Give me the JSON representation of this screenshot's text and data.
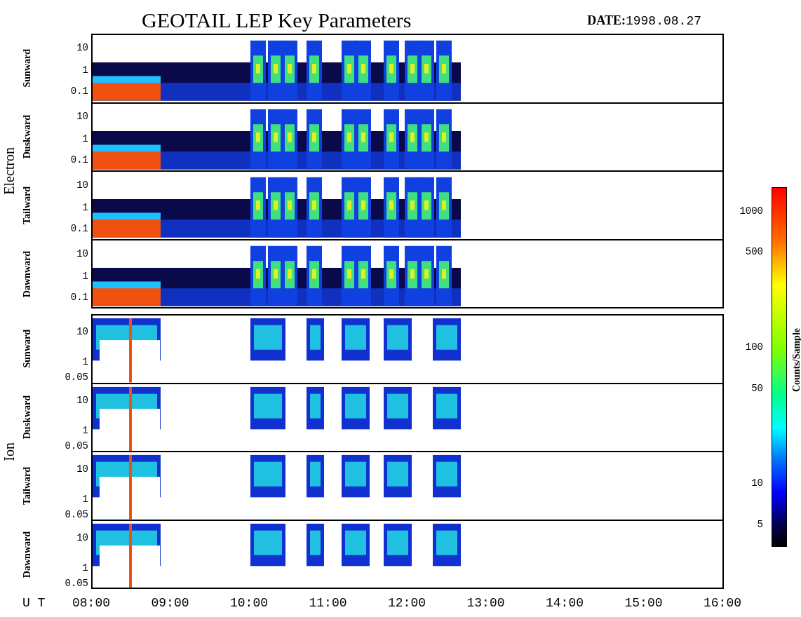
{
  "title": "GEOTAIL LEP Key Parameters",
  "date": {
    "label": "DATE:",
    "value": "1998.08.27"
  },
  "groups": [
    {
      "label": "Electron",
      "kind": "electron",
      "panels": [
        {
          "label": "Sunward",
          "ticks": [
            "10",
            "1",
            "0.1"
          ]
        },
        {
          "label": "Duskward",
          "ticks": [
            "10",
            "1",
            "0.1"
          ]
        },
        {
          "label": "Tailward",
          "ticks": [
            "10",
            "1",
            "0.1"
          ]
        },
        {
          "label": "Dawnward",
          "ticks": [
            "10",
            "1",
            "0.1"
          ]
        }
      ]
    },
    {
      "label": "Ion",
      "kind": "ion",
      "panels": [
        {
          "label": "Sunward",
          "ticks": [
            "10",
            "1",
            "0.05"
          ]
        },
        {
          "label": "Duskward",
          "ticks": [
            "10",
            "1",
            "0.05"
          ]
        },
        {
          "label": "Tailward",
          "ticks": [
            "10",
            "1",
            "0.05"
          ]
        },
        {
          "label": "Dawnward",
          "ticks": [
            "10",
            "1",
            "0.05"
          ]
        }
      ]
    }
  ],
  "x_axis": {
    "label": "U T",
    "ticks": [
      "08:00",
      "09:00",
      "10:00",
      "11:00",
      "12:00",
      "13:00",
      "14:00",
      "15:00",
      "16:00"
    ]
  },
  "colorbar": {
    "label": "Counts/Sample",
    "ticks": [
      "1000",
      "500",
      "100",
      "50",
      "10",
      "5"
    ]
  }
}
